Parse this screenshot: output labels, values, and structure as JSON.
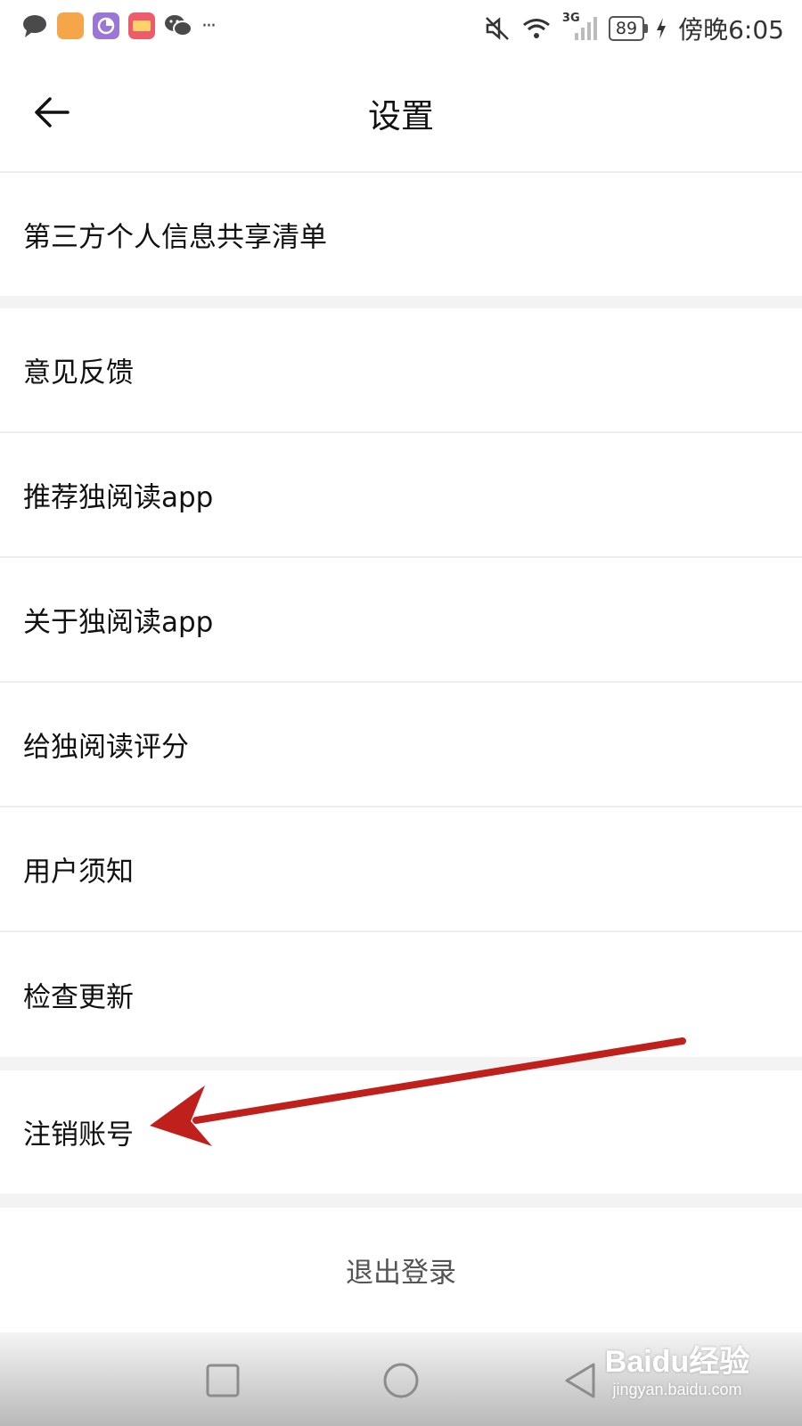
{
  "status_bar": {
    "time": "傍晚6:05",
    "battery": "89",
    "network": "3G",
    "apps": [
      "message-icon",
      "notes-icon",
      "photos-icon",
      "wallet-icon",
      "wechat-icon"
    ],
    "more": "···"
  },
  "header": {
    "title": "设置"
  },
  "settings": {
    "third_party": "第三方个人信息共享清单",
    "feedback": "意见反馈",
    "recommend": "推荐独阅读app",
    "about": "关于独阅读app",
    "rate": "给独阅读评分",
    "user_notice": "用户须知",
    "check_update": "检查更新",
    "cancel_account": "注销账号",
    "logout": "退出登录"
  },
  "watermark": {
    "logo": "Baidu经验",
    "url": "jingyan.baidu.com"
  },
  "colors": {
    "arrow": "#c0201c",
    "separator": "#f3f3f3",
    "text": "#111111"
  }
}
